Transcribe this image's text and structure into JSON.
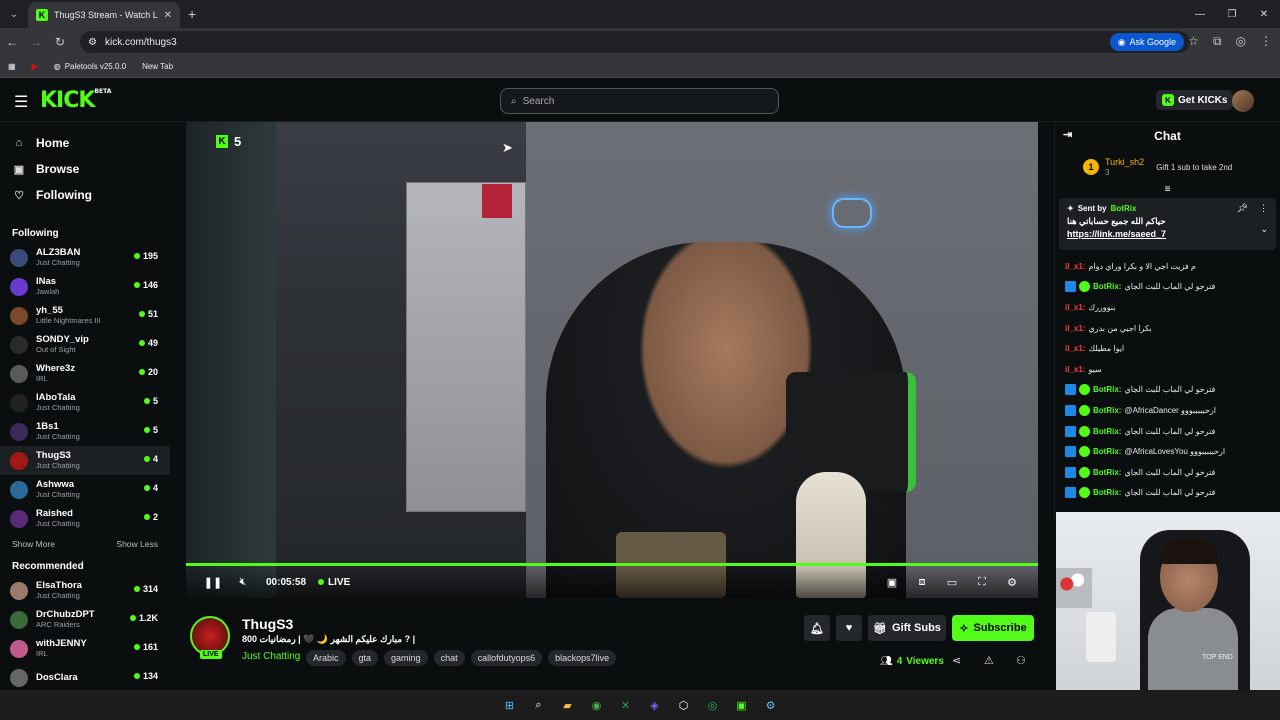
{
  "browser": {
    "tab_title": "ThugS3 Stream - Watch Live on",
    "url": "kick.com/thugs3",
    "ask_google": "Ask Google",
    "bookmarks": [
      "Paletools v25.0.0",
      "New Tab"
    ]
  },
  "header": {
    "logo": "KICK",
    "logo_sup": "BETA",
    "search_placeholder": "Search",
    "get_kicks": "Get KICKs"
  },
  "sidebar": {
    "nav": [
      {
        "label": "Home",
        "icon": "home-icon"
      },
      {
        "label": "Browse",
        "icon": "browse-icon"
      },
      {
        "label": "Following",
        "icon": "heart-icon"
      }
    ],
    "following_title": "Following",
    "following": [
      {
        "name": "ALZ3BAN",
        "sub": "Just Chatting",
        "count": "195",
        "color": "#3a4a7a"
      },
      {
        "name": "INas",
        "sub": "Jawlah",
        "count": "146",
        "color": "#6a3ad0"
      },
      {
        "name": "yh_55",
        "sub": "Little Nightmares III",
        "count": "51",
        "color": "#7a4a2a"
      },
      {
        "name": "SONDY_vip",
        "sub": "Out of Sight",
        "count": "49",
        "color": "#2a2a2a"
      },
      {
        "name": "Where3z",
        "sub": "IRL",
        "count": "20",
        "color": "#5a5a5a"
      },
      {
        "name": "lAboTala",
        "sub": "Just Chatting",
        "count": "5",
        "color": "#222"
      },
      {
        "name": "1Bs1",
        "sub": "Just Chatting",
        "count": "5",
        "color": "#3a2a5a"
      },
      {
        "name": "ThugS3",
        "sub": "Just Chatting",
        "count": "4",
        "color": "#a01818"
      },
      {
        "name": "Ashwwa",
        "sub": "Just Chatting",
        "count": "4",
        "color": "#2a6a9a"
      },
      {
        "name": "Raished",
        "sub": "Just Chatting",
        "count": "2",
        "color": "#5a2a7a"
      }
    ],
    "show_more": "Show More",
    "show_less": "Show Less",
    "recommended_title": "Recommended",
    "recommended": [
      {
        "name": "ElsaThora",
        "sub": "Just Chatting",
        "count": "314",
        "color": "#9a7a6a"
      },
      {
        "name": "DrChubzDPT",
        "sub": "ARC Raiders",
        "count": "1.2K",
        "color": "#3a6a3a"
      },
      {
        "name": "withJENNY",
        "sub": "IRL",
        "count": "161",
        "color": "#c05a8a"
      },
      {
        "name": "DosClara",
        "sub": "",
        "count": "134",
        "color": "#666"
      }
    ]
  },
  "player": {
    "viewer_badge": "5",
    "time": "00:05:58",
    "live": "LIVE",
    "progress": 1.0
  },
  "stream": {
    "live_badge": "LIVE",
    "name": "ThugS3",
    "title": "مبارك عليكم الشهر 🌙 🖤 | رمضانيات 800 ? |",
    "category": "Just Chatting",
    "tags": [
      "Arabic",
      "gta",
      "gaming",
      "chat",
      "callofdutyops6",
      "blackops7live"
    ],
    "gift_subs": "Gift Subs",
    "subscribe": "Subscribe",
    "viewers_count": "4",
    "viewers_label": "Viewers"
  },
  "chat": {
    "title": "Chat",
    "top_gifter": {
      "name": "Turki_sh2",
      "count": "3",
      "rank": "1",
      "message": "Gift 1 sub to take 2nd"
    },
    "pinned": {
      "sent_by": "Sent by",
      "bot": "BotRix",
      "text": "حياكم الله جميع حساباتي هنا",
      "link": "https://link.me/saeed_7"
    },
    "messages": [
      {
        "user": "il_x1:",
        "type": "red",
        "text": "م فزيت اجي الا و بكرا وراي دوام"
      },
      {
        "user": "BotRix:",
        "type": "bot",
        "text": "فترحو لي الماب للبث الجاي"
      },
      {
        "user": "il_x1:",
        "type": "red",
        "text": "بنووررك"
      },
      {
        "user": "il_x1:",
        "type": "red",
        "text": "بكرا اجيي من بدري"
      },
      {
        "user": "il_x1:",
        "type": "red",
        "text": "ايوا مطيلك"
      },
      {
        "user": "il_x1:",
        "type": "red",
        "text": "سيو"
      },
      {
        "user": "BotRix:",
        "type": "bot",
        "text": "فترحو لي الماب للبث الجاي"
      },
      {
        "user": "BotRix:",
        "type": "bot",
        "text": "@AfricaDancer ارحبببببووو"
      },
      {
        "user": "BotRix:",
        "type": "bot",
        "text": "فترحو لي الماب للبث الجاي"
      },
      {
        "user": "BotRix:",
        "type": "bot",
        "text": "@AfricaLovesYou ارحبببببووو"
      },
      {
        "user": "BotRix:",
        "type": "bot",
        "text": "فترحو لي الماب للبث الجاي"
      },
      {
        "user": "BotRix:",
        "type": "bot",
        "text": "فترحو لي الماب للبث الجاي"
      }
    ]
  },
  "webcam": {
    "shirt_text": "TOP END"
  }
}
